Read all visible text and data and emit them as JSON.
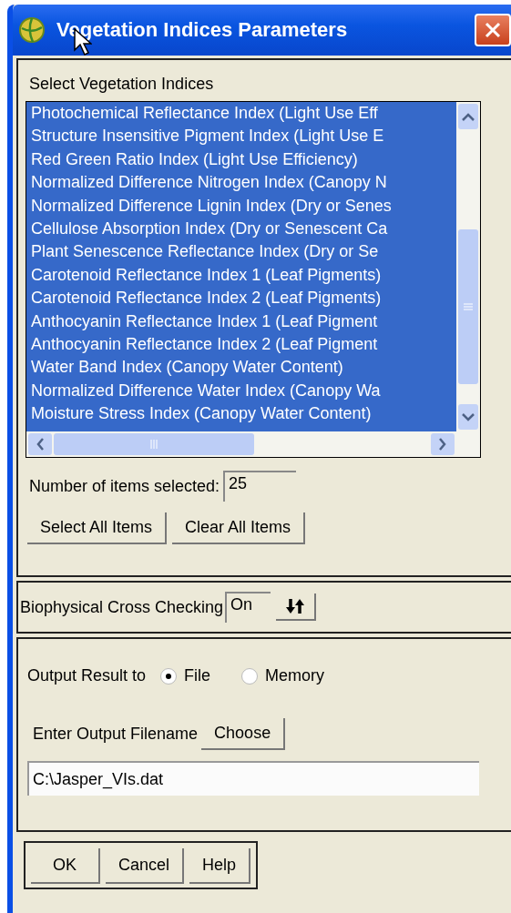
{
  "window": {
    "title": "Vegetation Indices Parameters"
  },
  "indices": {
    "heading": "Select Vegetation Indices",
    "items": [
      {
        "label": "Photochemical Reflectance Index (Light Use Eff",
        "selected": true
      },
      {
        "label": "Structure Insensitive Pigment Index (Light Use E",
        "selected": true
      },
      {
        "label": "Red Green Ratio Index (Light Use Efficiency)",
        "selected": true
      },
      {
        "label": "Normalized Difference Nitrogen Index (Canopy N",
        "selected": true
      },
      {
        "label": "Normalized Difference Lignin Index (Dry or Senes",
        "selected": true
      },
      {
        "label": "Cellulose Absorption Index (Dry or Senescent Ca",
        "selected": true
      },
      {
        "label": "Plant Senescence Reflectance Index (Dry or Se",
        "selected": true
      },
      {
        "label": "Carotenoid Reflectance Index 1 (Leaf Pigments)",
        "selected": true
      },
      {
        "label": "Carotenoid Reflectance Index 2 (Leaf Pigments)",
        "selected": true
      },
      {
        "label": "Anthocyanin Reflectance Index 1 (Leaf Pigment",
        "selected": true
      },
      {
        "label": "Anthocyanin Reflectance Index 2 (Leaf Pigment",
        "selected": true
      },
      {
        "label": "Water Band Index (Canopy Water Content)",
        "selected": true
      },
      {
        "label": "Normalized Difference Water Index (Canopy Wa",
        "selected": true
      },
      {
        "label": "Moisture Stress Index (Canopy Water Content)",
        "selected": true
      }
    ],
    "count_label": "Number of items selected:",
    "count_value": "25",
    "buttons": [
      "Select All Items",
      "Clear All Items"
    ]
  },
  "cross_check": {
    "label": "Biophysical Cross Checking",
    "value": "On"
  },
  "output": {
    "label": "Output Result to",
    "options": [
      {
        "label": "File",
        "selected": true
      },
      {
        "label": "Memory",
        "selected": false
      }
    ],
    "filename_label": "Enter Output Filename",
    "choose_button": "Choose",
    "filename": "C:\\Jasper_VIs.dat"
  },
  "footer_buttons": [
    "OK",
    "Cancel",
    "Help"
  ]
}
